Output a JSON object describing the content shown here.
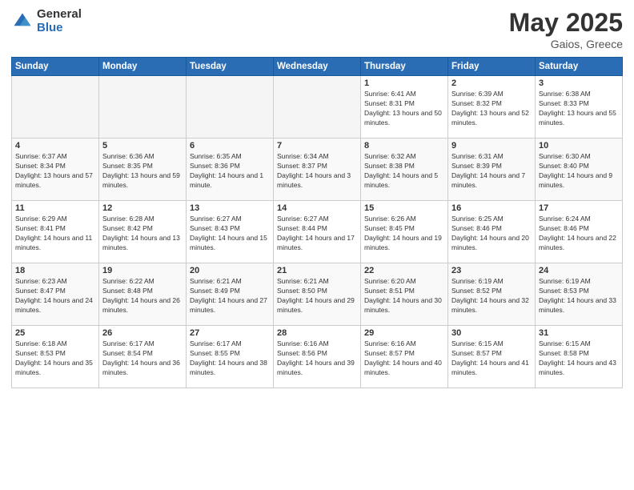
{
  "logo": {
    "general": "General",
    "blue": "Blue"
  },
  "title": {
    "month_year": "May 2025",
    "location": "Gaios, Greece"
  },
  "weekdays": [
    "Sunday",
    "Monday",
    "Tuesday",
    "Wednesday",
    "Thursday",
    "Friday",
    "Saturday"
  ],
  "weeks": [
    [
      {
        "day": "",
        "empty": true
      },
      {
        "day": "",
        "empty": true
      },
      {
        "day": "",
        "empty": true
      },
      {
        "day": "",
        "empty": true
      },
      {
        "day": "1",
        "sunrise": "6:41 AM",
        "sunset": "8:31 PM",
        "daylight": "13 hours and 50 minutes."
      },
      {
        "day": "2",
        "sunrise": "6:39 AM",
        "sunset": "8:32 PM",
        "daylight": "13 hours and 52 minutes."
      },
      {
        "day": "3",
        "sunrise": "6:38 AM",
        "sunset": "8:33 PM",
        "daylight": "13 hours and 55 minutes."
      }
    ],
    [
      {
        "day": "4",
        "sunrise": "6:37 AM",
        "sunset": "8:34 PM",
        "daylight": "13 hours and 57 minutes."
      },
      {
        "day": "5",
        "sunrise": "6:36 AM",
        "sunset": "8:35 PM",
        "daylight": "13 hours and 59 minutes."
      },
      {
        "day": "6",
        "sunrise": "6:35 AM",
        "sunset": "8:36 PM",
        "daylight": "14 hours and 1 minute."
      },
      {
        "day": "7",
        "sunrise": "6:34 AM",
        "sunset": "8:37 PM",
        "daylight": "14 hours and 3 minutes."
      },
      {
        "day": "8",
        "sunrise": "6:32 AM",
        "sunset": "8:38 PM",
        "daylight": "14 hours and 5 minutes."
      },
      {
        "day": "9",
        "sunrise": "6:31 AM",
        "sunset": "8:39 PM",
        "daylight": "14 hours and 7 minutes."
      },
      {
        "day": "10",
        "sunrise": "6:30 AM",
        "sunset": "8:40 PM",
        "daylight": "14 hours and 9 minutes."
      }
    ],
    [
      {
        "day": "11",
        "sunrise": "6:29 AM",
        "sunset": "8:41 PM",
        "daylight": "14 hours and 11 minutes."
      },
      {
        "day": "12",
        "sunrise": "6:28 AM",
        "sunset": "8:42 PM",
        "daylight": "14 hours and 13 minutes."
      },
      {
        "day": "13",
        "sunrise": "6:27 AM",
        "sunset": "8:43 PM",
        "daylight": "14 hours and 15 minutes."
      },
      {
        "day": "14",
        "sunrise": "6:27 AM",
        "sunset": "8:44 PM",
        "daylight": "14 hours and 17 minutes."
      },
      {
        "day": "15",
        "sunrise": "6:26 AM",
        "sunset": "8:45 PM",
        "daylight": "14 hours and 19 minutes."
      },
      {
        "day": "16",
        "sunrise": "6:25 AM",
        "sunset": "8:46 PM",
        "daylight": "14 hours and 20 minutes."
      },
      {
        "day": "17",
        "sunrise": "6:24 AM",
        "sunset": "8:46 PM",
        "daylight": "14 hours and 22 minutes."
      }
    ],
    [
      {
        "day": "18",
        "sunrise": "6:23 AM",
        "sunset": "8:47 PM",
        "daylight": "14 hours and 24 minutes."
      },
      {
        "day": "19",
        "sunrise": "6:22 AM",
        "sunset": "8:48 PM",
        "daylight": "14 hours and 26 minutes."
      },
      {
        "day": "20",
        "sunrise": "6:21 AM",
        "sunset": "8:49 PM",
        "daylight": "14 hours and 27 minutes."
      },
      {
        "day": "21",
        "sunrise": "6:21 AM",
        "sunset": "8:50 PM",
        "daylight": "14 hours and 29 minutes."
      },
      {
        "day": "22",
        "sunrise": "6:20 AM",
        "sunset": "8:51 PM",
        "daylight": "14 hours and 30 minutes."
      },
      {
        "day": "23",
        "sunrise": "6:19 AM",
        "sunset": "8:52 PM",
        "daylight": "14 hours and 32 minutes."
      },
      {
        "day": "24",
        "sunrise": "6:19 AM",
        "sunset": "8:53 PM",
        "daylight": "14 hours and 33 minutes."
      }
    ],
    [
      {
        "day": "25",
        "sunrise": "6:18 AM",
        "sunset": "8:53 PM",
        "daylight": "14 hours and 35 minutes."
      },
      {
        "day": "26",
        "sunrise": "6:17 AM",
        "sunset": "8:54 PM",
        "daylight": "14 hours and 36 minutes."
      },
      {
        "day": "27",
        "sunrise": "6:17 AM",
        "sunset": "8:55 PM",
        "daylight": "14 hours and 38 minutes."
      },
      {
        "day": "28",
        "sunrise": "6:16 AM",
        "sunset": "8:56 PM",
        "daylight": "14 hours and 39 minutes."
      },
      {
        "day": "29",
        "sunrise": "6:16 AM",
        "sunset": "8:57 PM",
        "daylight": "14 hours and 40 minutes."
      },
      {
        "day": "30",
        "sunrise": "6:15 AM",
        "sunset": "8:57 PM",
        "daylight": "14 hours and 41 minutes."
      },
      {
        "day": "31",
        "sunrise": "6:15 AM",
        "sunset": "8:58 PM",
        "daylight": "14 hours and 43 minutes."
      }
    ]
  ]
}
